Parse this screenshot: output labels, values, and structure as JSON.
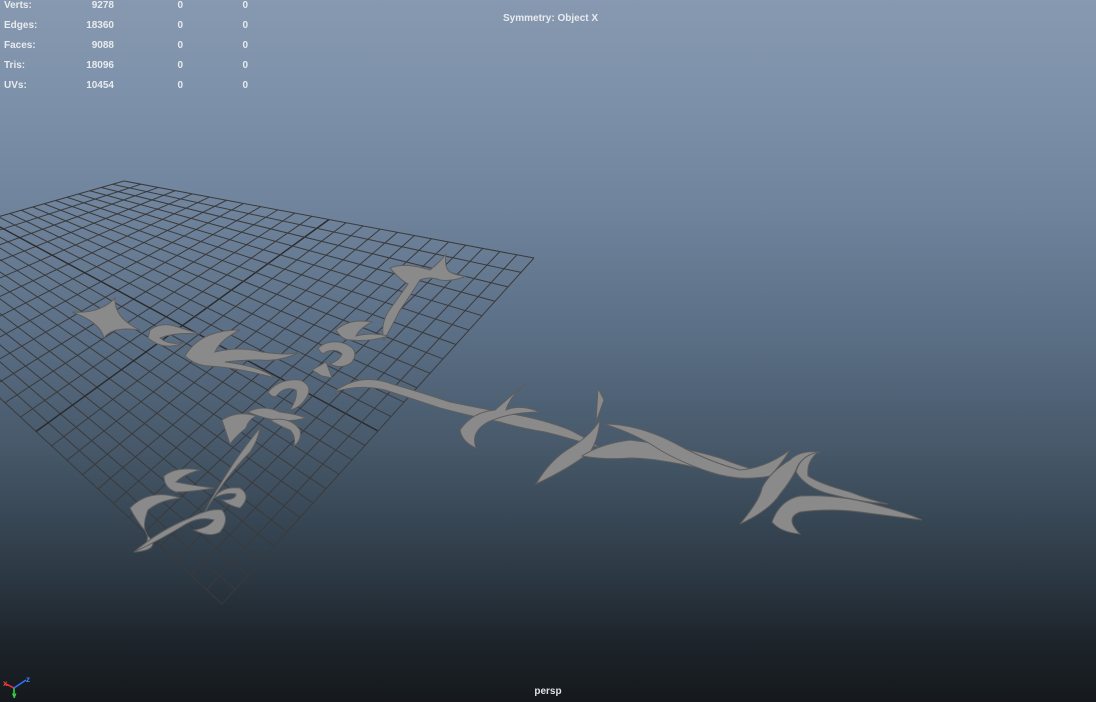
{
  "hud": {
    "rows": [
      {
        "label": "Verts:",
        "total": "9278",
        "selected": "0",
        "component": "0"
      },
      {
        "label": "Edges:",
        "total": "18360",
        "selected": "0",
        "component": "0"
      },
      {
        "label": "Faces:",
        "total": "9088",
        "selected": "0",
        "component": "0"
      },
      {
        "label": "Tris:",
        "total": "18096",
        "selected": "0",
        "component": "0"
      },
      {
        "label": "UVs:",
        "total": "10454",
        "selected": "0",
        "component": "0"
      }
    ]
  },
  "symmetry": "Symmetry: Object X",
  "camera": "persp",
  "axis_gizmo": {
    "x": "x",
    "y": "y",
    "z": "z"
  },
  "colors": {
    "grid_line": "#3a3a3c",
    "model_fill": "#8a8a8a",
    "model_edge": "#5e5e5e",
    "hud_text": "#e8ebee",
    "axis_x": "#e03030",
    "axis_y": "#30d040",
    "axis_z": "#3070ff"
  }
}
